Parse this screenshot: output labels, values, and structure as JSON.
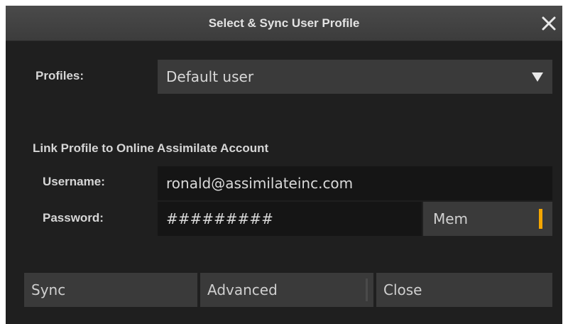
{
  "dialog": {
    "title": "Select & Sync User Profile",
    "close_icon": "close-icon"
  },
  "profiles": {
    "label": "Profiles:",
    "selected": "Default user",
    "dropdown_icon": "triangle-down-icon"
  },
  "link_section": {
    "heading": "Link Profile to Online Assimilate Account",
    "username_label": "Username:",
    "username_value": "ronald@assimilateinc.com",
    "password_label": "Password:",
    "password_value": "#########",
    "mem_label": "Mem",
    "mem_indicator_color": "#f4a600"
  },
  "buttons": {
    "sync": "Sync",
    "advanced": "Advanced",
    "close": "Close"
  }
}
